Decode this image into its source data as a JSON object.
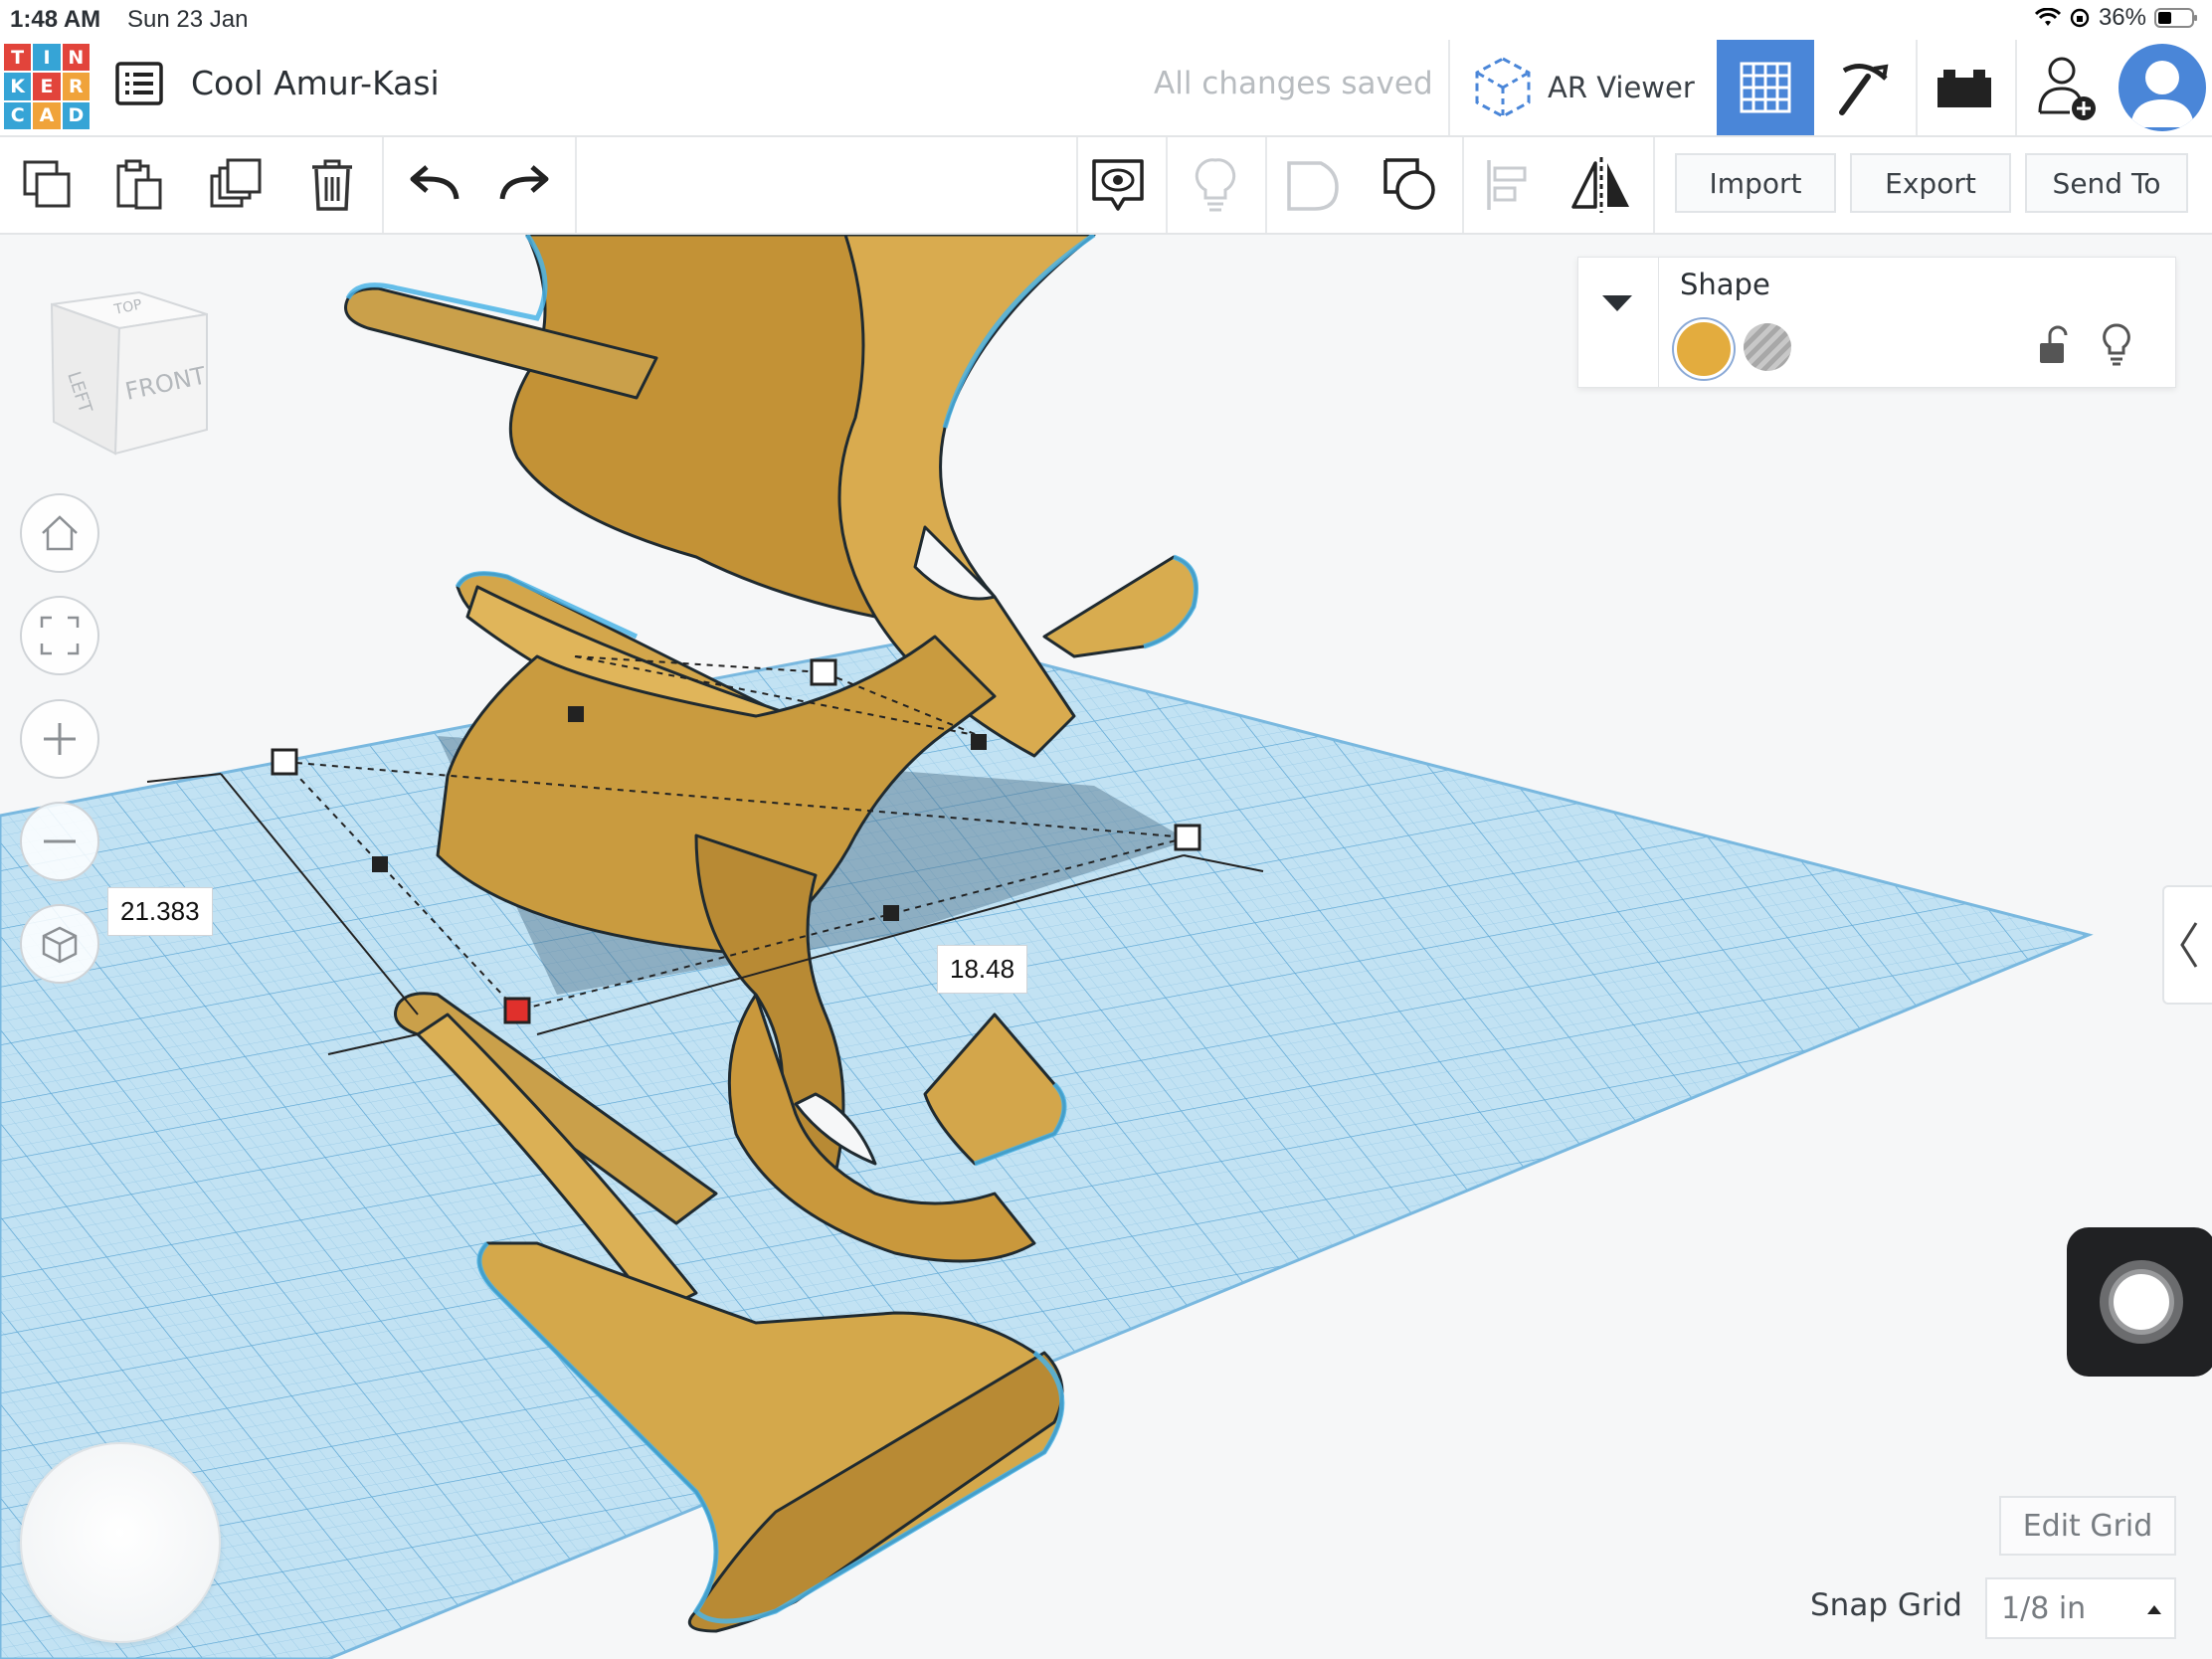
{
  "status_bar": {
    "time": "1:48 AM",
    "date": "Sun 23 Jan",
    "battery": "36%"
  },
  "logo": {
    "letters": [
      "T",
      "I",
      "N",
      "K",
      "E",
      "R",
      "C",
      "A",
      "D"
    ],
    "colors": [
      "#e2443b",
      "#36a4d6",
      "#e2443b",
      "#36a4d6",
      "#e2443b",
      "#f0a33a",
      "#36a4d6",
      "#f0a33a",
      "#36a4d6"
    ]
  },
  "header": {
    "design_title": "Cool Amur-Kasi",
    "save_status": "All changes saved",
    "ar_viewer_label": "AR Viewer",
    "icons": [
      "design-list-icon",
      "ar-cube-icon",
      "grid-3d-icon",
      "pickaxe-icon",
      "bricks-icon",
      "add-user-icon",
      "profile-avatar"
    ],
    "active_color": "#4a86d8"
  },
  "toolbar": {
    "icons": [
      "copy-icon",
      "paste-icon",
      "duplicate-icon",
      "delete-icon",
      "undo-icon",
      "redo-icon",
      "show-notes-icon",
      "light-bulb-icon",
      "group-icon",
      "ungroup-icon",
      "align-icon",
      "mirror-icon"
    ],
    "import_label": "Import",
    "export_label": "Export",
    "send_to_label": "Send To"
  },
  "shape_panel": {
    "title": "Shape",
    "solid_color": "#e3ac3e",
    "options": [
      "solid",
      "hole",
      "lock",
      "visibility"
    ]
  },
  "view_cube": {
    "top": "TOP",
    "left": "LEFT",
    "front": "FRONT"
  },
  "nav_controls": [
    "home-view",
    "fit-view",
    "zoom-in",
    "zoom-out",
    "ortho-view"
  ],
  "dimensions": {
    "width": "21.383",
    "depth": "18.48"
  },
  "bottom": {
    "edit_grid_label": "Edit Grid",
    "snap_grid_label": "Snap Grid",
    "snap_grid_value": "1/8 in"
  },
  "colors": {
    "workplane": "#b9dcf1",
    "shape": "#d6a949",
    "outline": "#4bb4e6"
  }
}
